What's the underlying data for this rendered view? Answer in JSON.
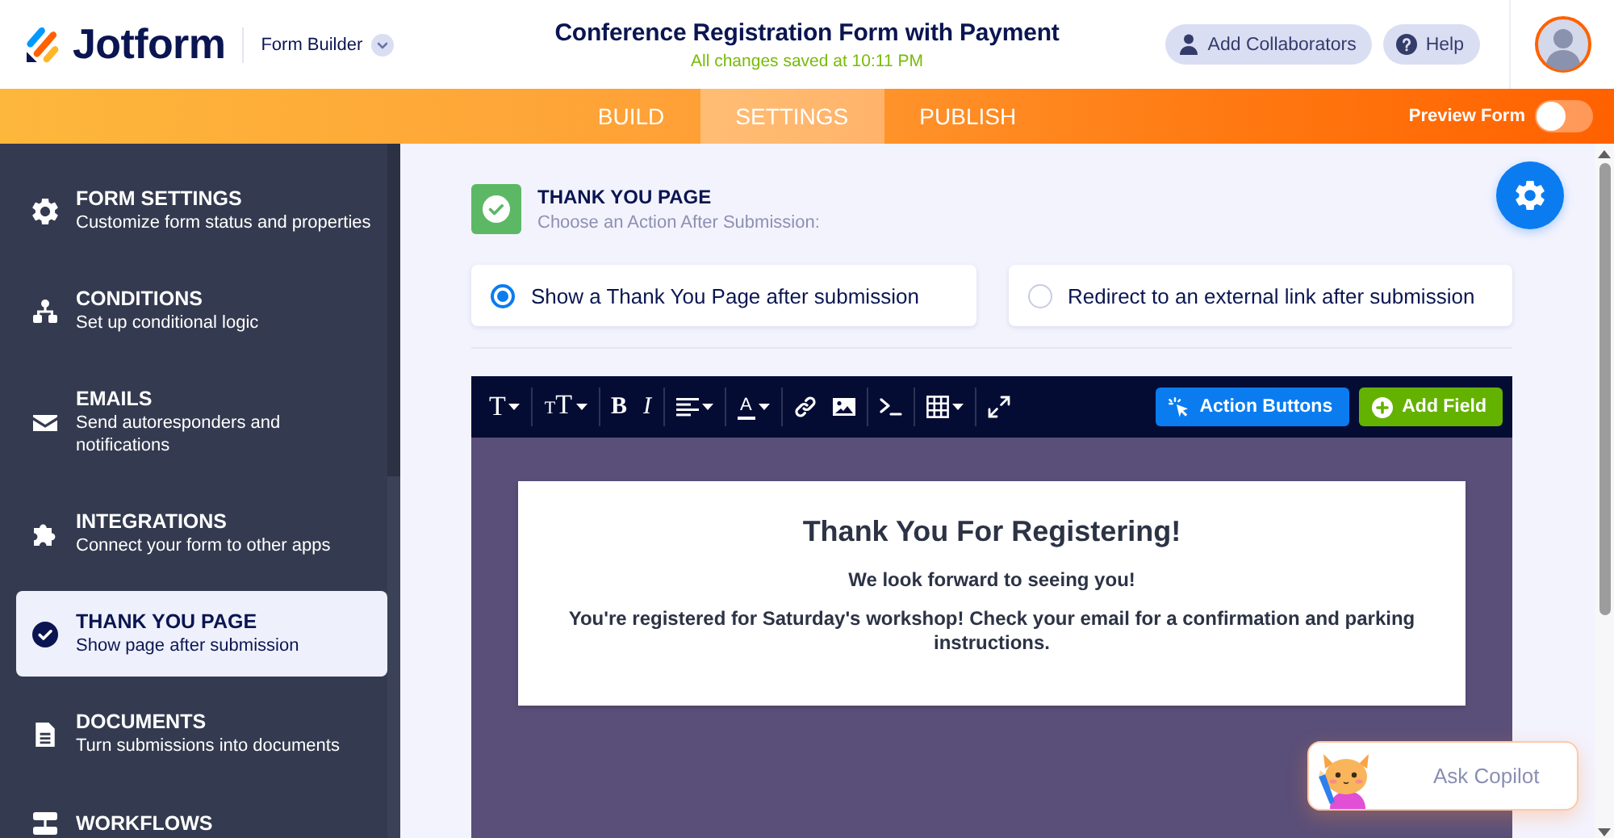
{
  "header": {
    "logo": "Jotform",
    "product": "Form Builder",
    "title": "Conference Registration Form with Payment",
    "status": "All changes saved at 10:11 PM",
    "actions": [
      {
        "kind": "collaborators",
        "label": "Add Collaborators"
      },
      {
        "kind": "help",
        "label": "Help"
      }
    ]
  },
  "nav": {
    "tabs": [
      {
        "label": "BUILD",
        "selected": false
      },
      {
        "label": "SETTINGS",
        "selected": true
      },
      {
        "label": "PUBLISH",
        "selected": false
      }
    ],
    "preview": {
      "label": "Preview Form",
      "on": false
    }
  },
  "sidebar": {
    "items": [
      {
        "kind": "settings",
        "title": "FORM SETTINGS",
        "subtitle": "Customize form status and properties",
        "selected": false
      },
      {
        "kind": "conditions",
        "title": "CONDITIONS",
        "subtitle": "Set up conditional logic",
        "selected": false
      },
      {
        "kind": "emails",
        "title": "EMAILS",
        "subtitle": "Send autoresponders and notifications",
        "selected": false
      },
      {
        "kind": "integrations",
        "title": "INTEGRATIONS",
        "subtitle": "Connect your form to other apps",
        "selected": false
      },
      {
        "kind": "thankyou",
        "title": "THANK YOU PAGE",
        "subtitle": "Show page after submission",
        "selected": true
      },
      {
        "kind": "documents",
        "title": "DOCUMENTS",
        "subtitle": "Turn submissions into documents",
        "selected": false
      },
      {
        "kind": "workflows",
        "title": "WORKFLOWS",
        "selected": false
      }
    ]
  },
  "panel": {
    "title": "THANK YOU PAGE",
    "subtitle": "Choose an Action After Submission:",
    "options": [
      {
        "label": "Show a Thank You Page after submission",
        "selected": true
      },
      {
        "label": "Redirect to an external link after submission",
        "selected": false
      }
    ]
  },
  "editor": {
    "toolbar": {
      "groups": [
        [
          {
            "kind": "font",
            "label": "T",
            "menu": true
          }
        ],
        [
          {
            "kind": "size",
            "label": "TT",
            "menu": true
          }
        ],
        [
          {
            "kind": "bold",
            "label": "B"
          },
          {
            "kind": "italic",
            "label": "I"
          }
        ],
        [
          {
            "kind": "align",
            "menu": true
          }
        ],
        [
          {
            "kind": "color",
            "label": "A",
            "menu": true
          }
        ],
        [
          {
            "kind": "link"
          },
          {
            "kind": "image"
          }
        ],
        [
          {
            "kind": "code"
          }
        ],
        [
          {
            "kind": "table",
            "menu": true
          }
        ],
        [
          {
            "kind": "expand"
          }
        ]
      ],
      "buttons": [
        {
          "kind": "action",
          "label": "Action Buttons"
        },
        {
          "kind": "add",
          "label": "Add Field"
        }
      ]
    },
    "content": {
      "heading": "Thank You For Registering!",
      "lines": [
        "We look forward to seeing you!",
        "You're registered for Saturday's workshop! Check your email for a confirmation and parking instructions."
      ]
    }
  },
  "copilot": {
    "label": "Ask Copilot"
  }
}
